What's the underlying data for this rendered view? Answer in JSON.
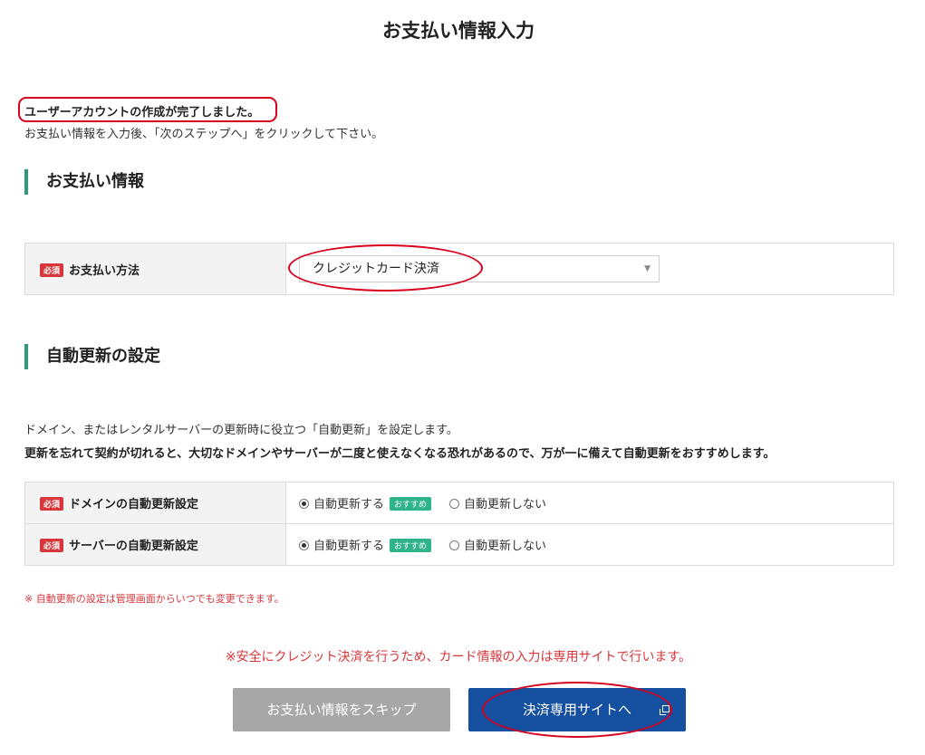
{
  "page": {
    "title": "お支払い情報入力"
  },
  "intro": {
    "done_message": "ユーザーアカウントの作成が完了しました。",
    "instruction": "お支払い情報を入力後、「次のステップへ」をクリックして下さい。"
  },
  "payment_section": {
    "heading": "お支払い情報",
    "method_label": "お支払い方法",
    "required_badge": "必須",
    "method_value": "クレジットカード決済"
  },
  "auto_renew_section": {
    "heading": "自動更新の設定",
    "desc1": "ドメイン、またはレンタルサーバーの更新時に役立つ「自動更新」を設定します。",
    "desc2": "更新を忘れて契約が切れると、大切なドメインやサーバーが二度と使えなくなる恐れがあるので、万が一に備えて自動更新をおすすめします。",
    "rows": [
      {
        "label": "ドメインの自動更新設定",
        "required": "必須",
        "option_on": "自動更新する",
        "recommend": "おすすめ",
        "option_off": "自動更新しない",
        "selected": "on"
      },
      {
        "label": "サーバーの自動更新設定",
        "required": "必須",
        "option_on": "自動更新する",
        "recommend": "おすすめ",
        "option_off": "自動更新しない",
        "selected": "on"
      }
    ],
    "note": "※ 自動更新の設定は管理画面からいつでも変更できます。"
  },
  "footer": {
    "secure_note": "※安全にクレジット決済を行うため、カード情報の入力は専用サイトで行います。",
    "skip_button": "お支払い情報をスキップ",
    "pay_button": "決済専用サイトへ"
  },
  "colors": {
    "accent_green": "#2f9a73",
    "primary_blue": "#144fa0",
    "required_red": "#d8363a",
    "annotation_red": "#d8001c"
  }
}
